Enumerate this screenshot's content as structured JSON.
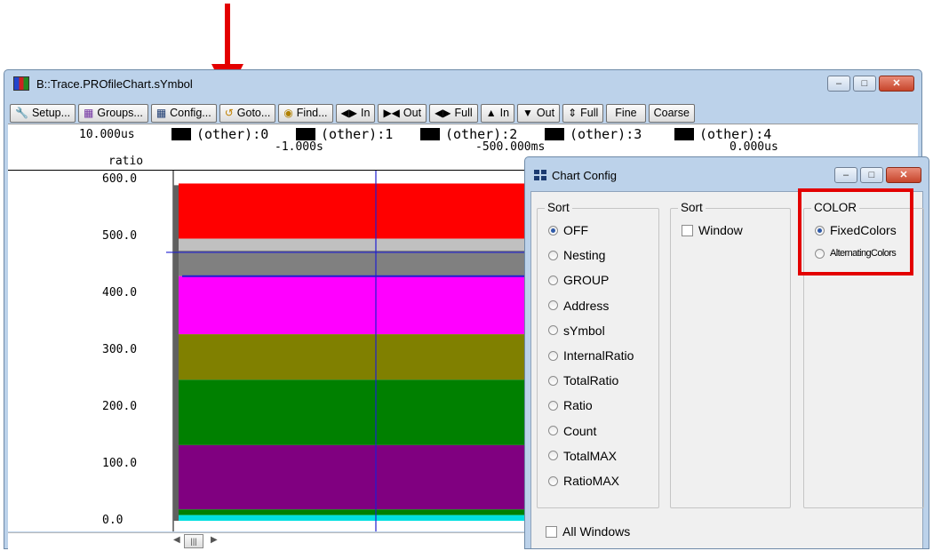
{
  "annotation": {
    "arrow_color": "#e30000",
    "highlight_color": "#e30000"
  },
  "main_window": {
    "title": "B::Trace.PROfileChart.sYmbol",
    "toolbar": [
      {
        "icon": "wrench-icon",
        "label": "Setup..."
      },
      {
        "icon": "groups-icon",
        "label": "Groups..."
      },
      {
        "icon": "config-icon",
        "label": "Config..."
      },
      {
        "icon": "goto-icon",
        "label": "Goto..."
      },
      {
        "icon": "binoculars-icon",
        "label": "Find..."
      },
      {
        "icon": "zoom-in-h-icon",
        "label": "In"
      },
      {
        "icon": "zoom-out-h-icon",
        "label": "Out"
      },
      {
        "icon": "full-h-icon",
        "label": "Full"
      },
      {
        "icon": "zoom-in-v-icon",
        "label": "In"
      },
      {
        "icon": "zoom-out-v-icon",
        "label": "Out"
      },
      {
        "icon": "full-v-icon",
        "label": "Full"
      },
      {
        "icon": "",
        "label": "Fine"
      },
      {
        "icon": "",
        "label": "Coarse"
      }
    ],
    "scale": "10.000us",
    "legend": [
      "(other):0",
      "(other):1",
      "(other):2",
      "(other):3",
      "(other):4"
    ],
    "time_ticks": [
      "-1.000s",
      "-500.000ms",
      "0.000us"
    ],
    "y_axis_title": "ratio"
  },
  "chart_data": {
    "type": "area",
    "ylabel": "ratio",
    "ylim": [
      0,
      600
    ],
    "y_ticks": [
      "600.0",
      "500.0",
      "400.0",
      "300.0",
      "200.0",
      "100.0",
      "0.0"
    ],
    "x_ticks": [
      "-1.000s",
      "-500.000ms",
      "0.000us"
    ],
    "bands": [
      {
        "color": "#ff0000",
        "from": 496,
        "to": 593
      },
      {
        "color": "#c0c0c0",
        "from": 475,
        "to": 496
      },
      {
        "color": "#808080",
        "from": 430,
        "to": 475
      },
      {
        "color": "#ff00ff",
        "from": 328,
        "to": 430
      },
      {
        "color": "#808000",
        "from": 248,
        "to": 328
      },
      {
        "color": "#008000",
        "from": 133,
        "to": 248
      },
      {
        "color": "#800080",
        "from": 20,
        "to": 133
      },
      {
        "color": "#008000",
        "from": 10,
        "to": 20
      },
      {
        "color": "#00e0e0",
        "from": 0,
        "to": 10
      }
    ]
  },
  "config_dialog": {
    "title": "Chart Config",
    "sort_group": {
      "title": "Sort",
      "options": [
        "OFF",
        "Nesting",
        "GROUP",
        "Address",
        "sYmbol",
        "InternalRatio",
        "TotalRatio",
        "Ratio",
        "Count",
        "TotalMAX",
        "RatioMAX"
      ],
      "selected": "OFF"
    },
    "sort2_group": {
      "title": "Sort",
      "window_label": "Window"
    },
    "color_group": {
      "title": "COLOR",
      "options": [
        "FixedColors",
        "AlternatingColors"
      ],
      "selected": "FixedColors"
    },
    "all_windows_label": "All Windows"
  }
}
